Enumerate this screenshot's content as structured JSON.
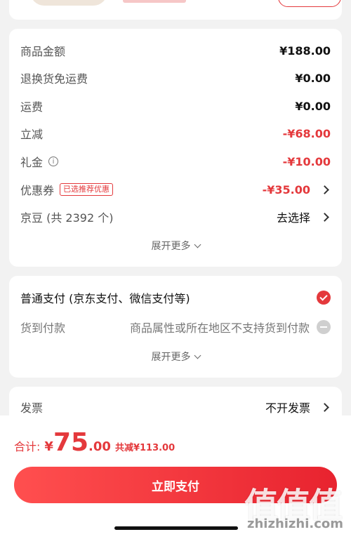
{
  "price_card": {
    "rows": [
      {
        "label": "商品金额",
        "value": "¥188.00"
      },
      {
        "label": "退换货免运费",
        "value": "¥0.00"
      },
      {
        "label": "运费",
        "value": "¥0.00"
      },
      {
        "label": "立减",
        "value": "-¥68.00"
      },
      {
        "label": "礼金",
        "value": "-¥10.00"
      },
      {
        "label": "优惠券",
        "tag": "已选推荐优惠",
        "value": "-¥35.00"
      },
      {
        "label": "京豆 (共 2392 个)",
        "value": "去选择"
      }
    ],
    "expand_more": "展开更多"
  },
  "payment_card": {
    "method": "普通支付 (京东支付、微信支付等)",
    "cod_label": "货到付款",
    "cod_note": "商品属性或所在地区不支持货到付款",
    "expand_more": "展开更多"
  },
  "invoice_card": {
    "label": "发票",
    "value": "不开发票"
  },
  "footer": {
    "total_label": "合计:",
    "currency": "¥",
    "amount_int": "75",
    "amount_dec": ".00",
    "saved": "共减¥113.00",
    "pay_button": "立即支付"
  },
  "watermark": {
    "logo": "值值值",
    "url": "zhizhizhi.com"
  },
  "colors": {
    "accent": "#e4393c",
    "background": "#f2f2f2"
  }
}
